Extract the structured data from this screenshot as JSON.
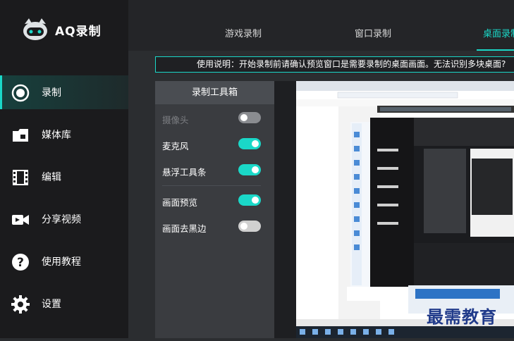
{
  "app": {
    "name": "AQ录制"
  },
  "sidebar": {
    "items": [
      {
        "label": "录制",
        "icon": "record-icon",
        "active": true
      },
      {
        "label": "媒体库",
        "icon": "folder-icon",
        "active": false
      },
      {
        "label": "编辑",
        "icon": "film-icon",
        "active": false
      },
      {
        "label": "分享视频",
        "icon": "video-camera-icon",
        "active": false
      },
      {
        "label": "使用教程",
        "icon": "help-icon",
        "active": false
      },
      {
        "label": "设置",
        "icon": "gear-icon",
        "active": false
      }
    ]
  },
  "tabs": [
    {
      "label": "游戏录制",
      "active": false
    },
    {
      "label": "窗口录制",
      "active": false
    },
    {
      "label": "桌面录制",
      "active": true
    }
  ],
  "notice": {
    "text": "使用说明：开始录制前请确认预览窗口是需要录制的桌面画面。无法识别多块桌面?"
  },
  "toolbox": {
    "title": "录制工具箱",
    "items": [
      {
        "label": "摄像头",
        "state": "off",
        "enabled": false
      },
      {
        "label": "麦克风",
        "state": "on",
        "enabled": true
      },
      {
        "label": "悬浮工具条",
        "state": "on",
        "enabled": true
      },
      {
        "label": "画面预览",
        "state": "on",
        "enabled": true
      },
      {
        "label": "画面去黑边",
        "state": "off",
        "enabled": true
      }
    ]
  },
  "watermark": {
    "text": "最需教育"
  },
  "colors": {
    "accent": "#1ad8c8",
    "sidebar_bg": "#1b1b1d",
    "main_bg": "#2b2d30"
  }
}
